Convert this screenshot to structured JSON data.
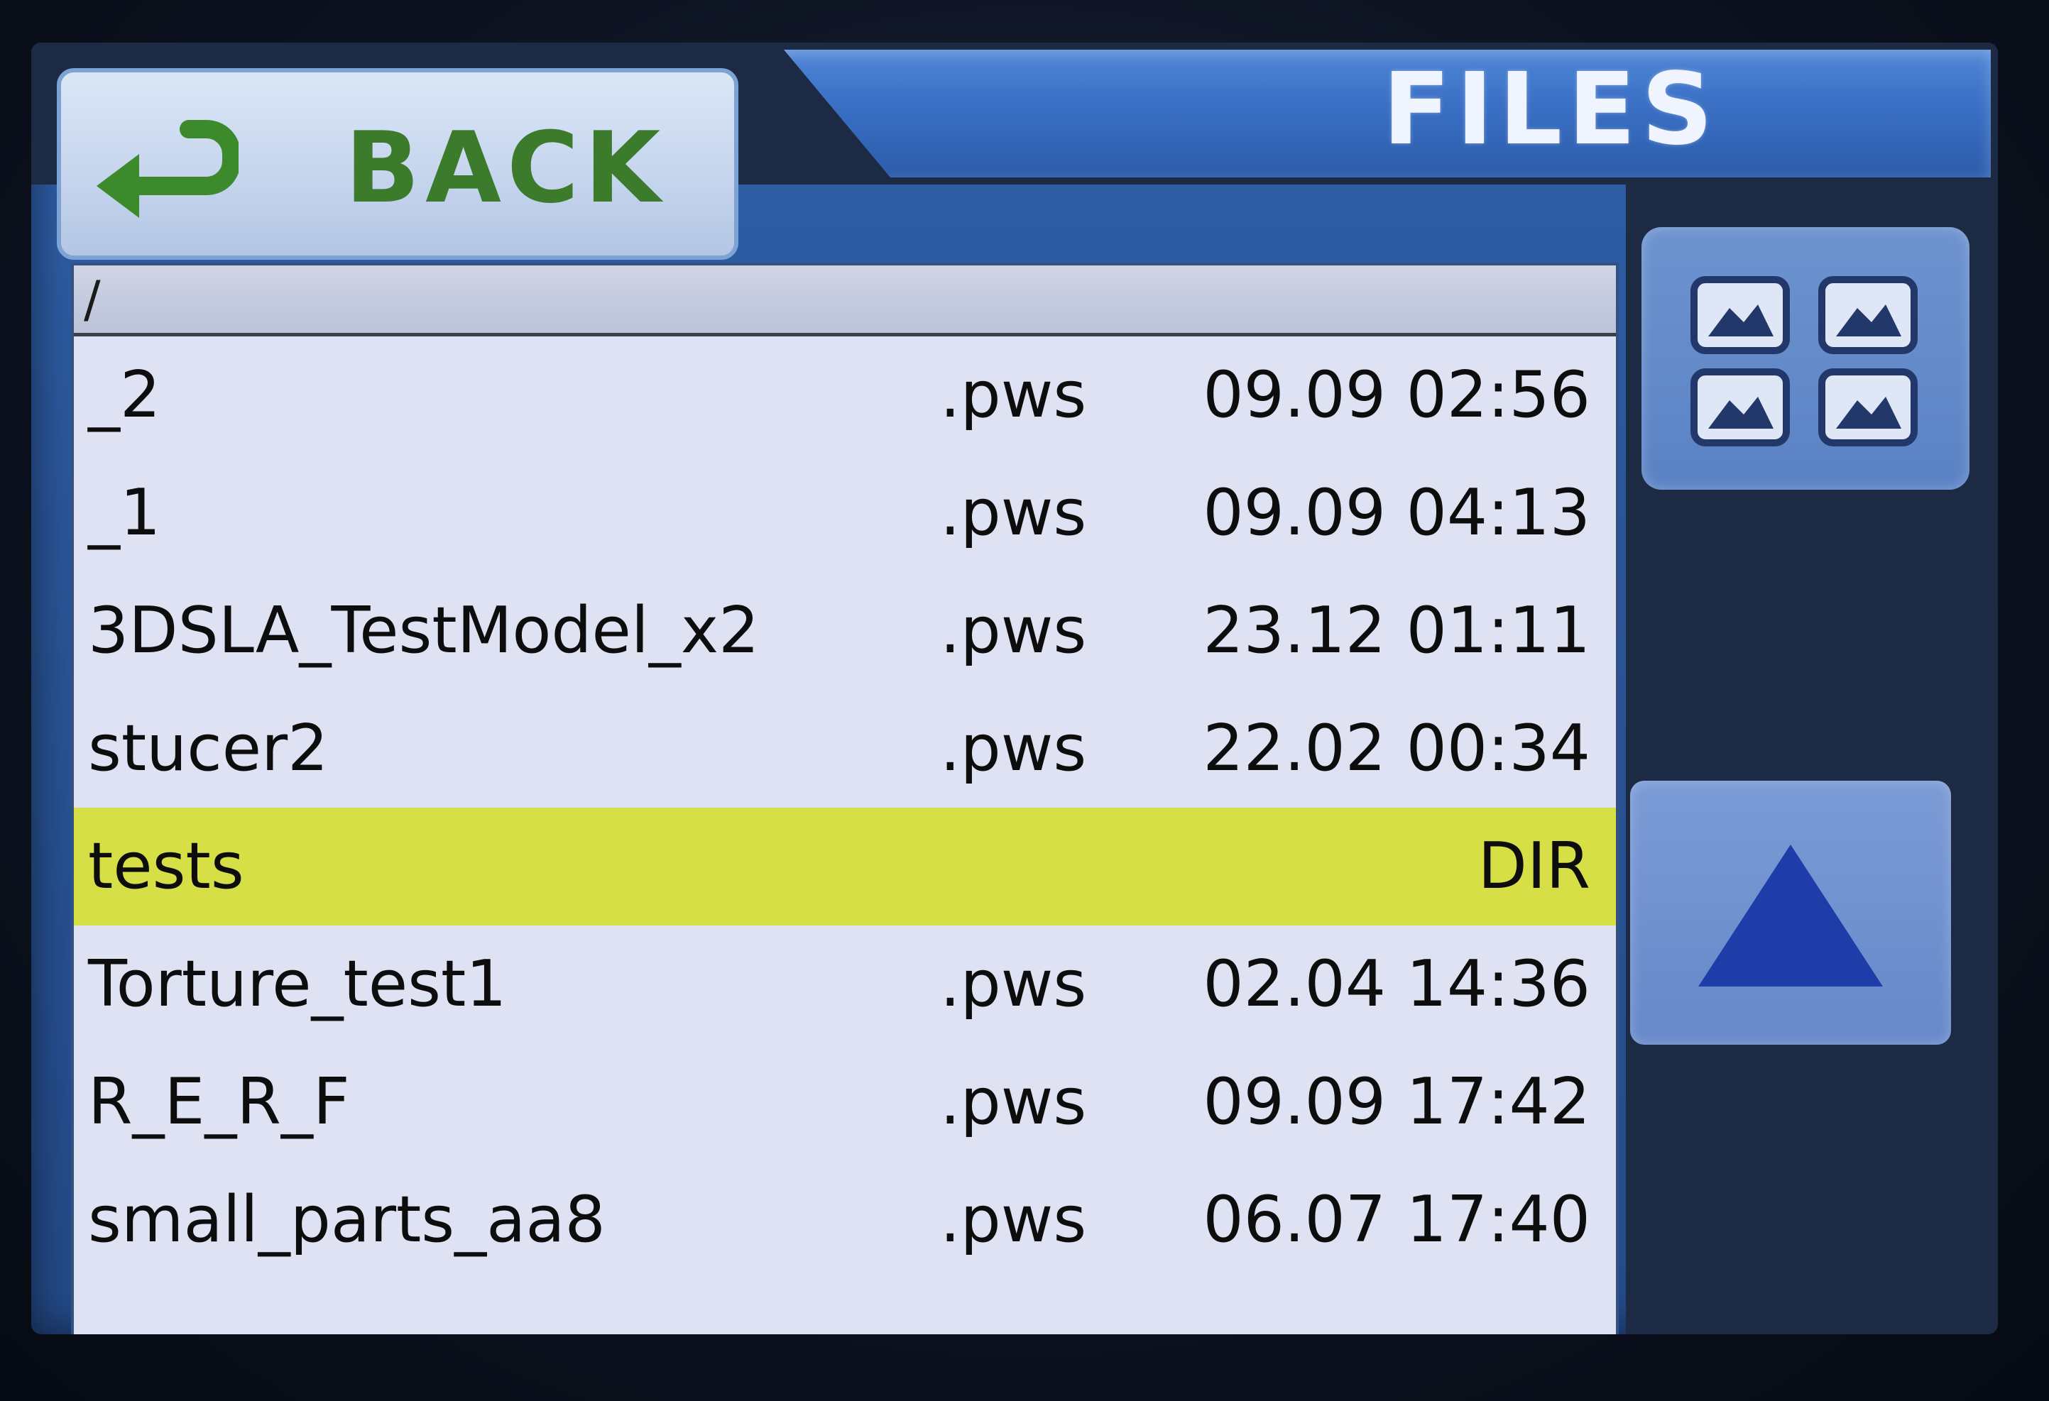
{
  "header": {
    "title": "FILES",
    "back_label": "BACK"
  },
  "path": "/",
  "files": [
    {
      "name": "_2",
      "ext": ".pws",
      "date": "09.09 02:56",
      "selected": false
    },
    {
      "name": "_1",
      "ext": ".pws",
      "date": "09.09 04:13",
      "selected": false
    },
    {
      "name": "3DSLA_TestModel_x2",
      "ext": ".pws",
      "date": "23.12 01:11",
      "selected": false
    },
    {
      "name": "stucer2",
      "ext": ".pws",
      "date": "22.02 00:34",
      "selected": false
    },
    {
      "name": "tests",
      "ext": "",
      "date": "DIR",
      "selected": true
    },
    {
      "name": "Torture_test1",
      "ext": ".pws",
      "date": "02.04 14:36",
      "selected": false
    },
    {
      "name": "R_E_R_F",
      "ext": ".pws",
      "date": "09.09 17:42",
      "selected": false
    },
    {
      "name": "small_parts_aa8",
      "ext": ".pws",
      "date": "06.07 17:40",
      "selected": false
    }
  ],
  "controls": {
    "back_icon": "return-arrow-icon",
    "thumb_icon": "thumbnail-grid-icon",
    "scroll_icon": "triangle-up-icon"
  },
  "colors": {
    "selected_row": "#d6e046",
    "back_text": "#3c7a2c",
    "title_text": "#f0f4ff",
    "list_bg": "#dfe2f3"
  }
}
